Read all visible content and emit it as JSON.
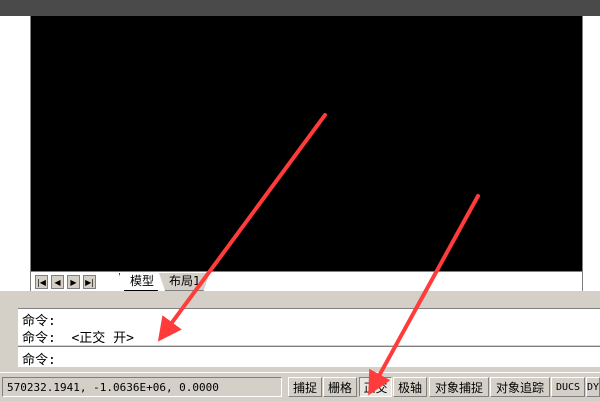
{
  "layout_tabs": [
    "模型",
    "布局1"
  ],
  "nav_buttons": [
    "|◀",
    "◀",
    "▶",
    "▶|"
  ],
  "command_history": [
    "命令:",
    "命令:  <正交 开>"
  ],
  "command_prompt": "命令:",
  "status": {
    "coordinates": "570232.1941, -1.0636E+06, 0.0000",
    "toggles": [
      {
        "label": "捕捉",
        "on": false
      },
      {
        "label": "栅格",
        "on": false
      },
      {
        "label": "正交",
        "on": true
      },
      {
        "label": "极轴",
        "on": false
      },
      {
        "label": "对象捕捉",
        "on": false
      },
      {
        "label": "对象追踪",
        "on": false
      },
      {
        "label": "DUCS",
        "on": false
      },
      {
        "label": "DY",
        "on": false
      }
    ]
  },
  "colors": {
    "annotation_arrow": "#ff3b3b",
    "canvas": "#000000"
  }
}
